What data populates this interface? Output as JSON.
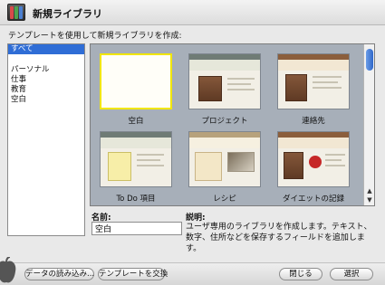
{
  "window": {
    "title": "新規ライブラリ"
  },
  "subtitle": "テンプレートを使用して新規ライブラリを作成:",
  "categories": [
    {
      "label": "すべて",
      "selected": true
    },
    {
      "label": "",
      "selected": false
    },
    {
      "label": "パーソナル",
      "selected": false
    },
    {
      "label": "仕事",
      "selected": false
    },
    {
      "label": "教育",
      "selected": false
    },
    {
      "label": "空白",
      "selected": false
    }
  ],
  "templates": [
    {
      "label": "空白",
      "selected": true
    },
    {
      "label": "プロジェクト",
      "selected": false
    },
    {
      "label": "連絡先",
      "selected": false
    },
    {
      "label": "To Do 項目",
      "selected": false
    },
    {
      "label": "レシピ",
      "selected": false
    },
    {
      "label": "ダイエットの記録",
      "selected": false
    }
  ],
  "name_field": {
    "label": "名前:",
    "value": "空白"
  },
  "description": {
    "label": "説明:",
    "text": "ユーザ専用のライブラリを作成します。テキスト、数字、住所などを保存するフィールドを追加します。"
  },
  "buttons": {
    "import": "データの読み込み...",
    "swap_template": "テンプレートを交換",
    "close": "閉じる",
    "choose": "選択"
  },
  "icons": {
    "app": "bento-app-icon",
    "apple": "apple-icon"
  },
  "colors": {
    "selection_blue": "#2f6dd6",
    "selected_template_border": "#f1e600"
  }
}
